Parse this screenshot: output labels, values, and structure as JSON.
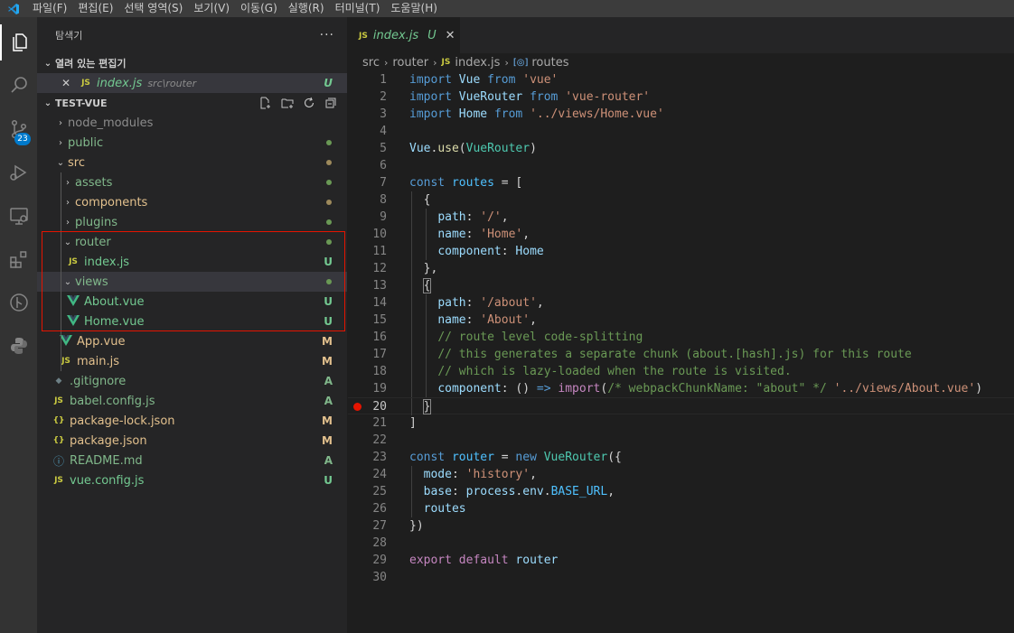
{
  "menu": [
    "파일(F)",
    "편집(E)",
    "선택 영역(S)",
    "보기(V)",
    "이동(G)",
    "실행(R)",
    "터미널(T)",
    "도움말(H)"
  ],
  "activity": {
    "scm_badge": "23"
  },
  "sidebar": {
    "title": "탐색기",
    "more": "···",
    "open_editors": {
      "heading": "열려 있는 편집기",
      "item": {
        "close": "✕",
        "icon": "JS",
        "name": "index.js",
        "path": "src\\router",
        "status": "U"
      }
    },
    "project": {
      "heading": "TEST-VUE"
    },
    "tree": [
      {
        "label": "node_modules",
        "twisty": "›",
        "status": ""
      },
      {
        "label": "public",
        "twisty": "›",
        "status": ""
      },
      {
        "label": "src",
        "twisty": "⌄",
        "status": ""
      },
      {
        "label": "assets",
        "twisty": "›",
        "status": ""
      },
      {
        "label": "components",
        "twisty": "›",
        "status": ""
      },
      {
        "label": "plugins",
        "twisty": "›",
        "status": ""
      },
      {
        "label": "router",
        "twisty": "⌄",
        "status": ""
      },
      {
        "label": "index.js",
        "icon": "JS",
        "status": "U"
      },
      {
        "label": "views",
        "twisty": "⌄",
        "status": ""
      },
      {
        "label": "About.vue",
        "icon": "V",
        "status": "U"
      },
      {
        "label": "Home.vue",
        "icon": "V",
        "status": "U"
      },
      {
        "label": "App.vue",
        "icon": "V",
        "status": "M"
      },
      {
        "label": "main.js",
        "icon": "JS",
        "status": "M"
      },
      {
        "label": ".gitignore",
        "icon": "◆",
        "status": "A"
      },
      {
        "label": "babel.config.js",
        "icon": "JS",
        "status": "A"
      },
      {
        "label": "package-lock.json",
        "icon": "{}",
        "status": "M"
      },
      {
        "label": "package.json",
        "icon": "{}",
        "status": "M"
      },
      {
        "label": "README.md",
        "icon": "ⓘ",
        "status": "A"
      },
      {
        "label": "vue.config.js",
        "icon": "JS",
        "status": "U"
      }
    ]
  },
  "editor": {
    "tab": {
      "icon": "JS",
      "name": "index.js",
      "status": "U",
      "close": "✕"
    },
    "breadcrumb": {
      "folder1": "src",
      "folder2": "router",
      "icon": "JS",
      "file": "index.js",
      "symbol_icon": "[◎]",
      "symbol": "routes"
    },
    "line_numbers": [
      "1",
      "2",
      "3",
      "4",
      "5",
      "6",
      "7",
      "8",
      "9",
      "10",
      "11",
      "12",
      "13",
      "14",
      "15",
      "16",
      "17",
      "18",
      "19",
      "20",
      "21",
      "22",
      "23",
      "24",
      "25",
      "26",
      "27",
      "28",
      "29",
      "30"
    ],
    "breakpoint_line": "20",
    "code": [
      [
        [
          "k",
          "import"
        ],
        [
          "p",
          " "
        ],
        [
          "v",
          "Vue"
        ],
        [
          "p",
          " "
        ],
        [
          "k",
          "from"
        ],
        [
          "p",
          " "
        ],
        [
          "s",
          "'vue'"
        ]
      ],
      [
        [
          "k",
          "import"
        ],
        [
          "p",
          " "
        ],
        [
          "v",
          "VueRouter"
        ],
        [
          "p",
          " "
        ],
        [
          "k",
          "from"
        ],
        [
          "p",
          " "
        ],
        [
          "s",
          "'vue-router'"
        ]
      ],
      [
        [
          "k",
          "import"
        ],
        [
          "p",
          " "
        ],
        [
          "v",
          "Home"
        ],
        [
          "p",
          " "
        ],
        [
          "k",
          "from"
        ],
        [
          "p",
          " "
        ],
        [
          "s",
          "'../views/Home.vue'"
        ]
      ],
      [],
      [
        [
          "v",
          "Vue"
        ],
        [
          "p",
          "."
        ],
        [
          "fn",
          "use"
        ],
        [
          "p",
          "("
        ],
        [
          "cl",
          "VueRouter"
        ],
        [
          "p",
          ")"
        ]
      ],
      [],
      [
        [
          "k",
          "const"
        ],
        [
          "p",
          " "
        ],
        [
          "cn",
          "routes"
        ],
        [
          "p",
          " = ["
        ]
      ],
      [
        [
          "p",
          "  {"
        ]
      ],
      [
        [
          "p",
          "    "
        ],
        [
          "v",
          "path"
        ],
        [
          "p",
          ": "
        ],
        [
          "s",
          "'/'"
        ],
        [
          "p",
          ","
        ]
      ],
      [
        [
          "p",
          "    "
        ],
        [
          "v",
          "name"
        ],
        [
          "p",
          ": "
        ],
        [
          "s",
          "'Home'"
        ],
        [
          "p",
          ","
        ]
      ],
      [
        [
          "p",
          "    "
        ],
        [
          "v",
          "component"
        ],
        [
          "p",
          ": "
        ],
        [
          "v",
          "Home"
        ]
      ],
      [
        [
          "p",
          "  },"
        ]
      ],
      [
        [
          "p",
          "  "
        ],
        [
          "bm",
          "{"
        ]
      ],
      [
        [
          "p",
          "    "
        ],
        [
          "v",
          "path"
        ],
        [
          "p",
          ": "
        ],
        [
          "s",
          "'/about'"
        ],
        [
          "p",
          ","
        ]
      ],
      [
        [
          "p",
          "    "
        ],
        [
          "v",
          "name"
        ],
        [
          "p",
          ": "
        ],
        [
          "s",
          "'About'"
        ],
        [
          "p",
          ","
        ]
      ],
      [
        [
          "p",
          "    "
        ],
        [
          "cm",
          "// route level code-splitting"
        ]
      ],
      [
        [
          "p",
          "    "
        ],
        [
          "cm",
          "// this generates a separate chunk (about.[hash].js) for this route"
        ]
      ],
      [
        [
          "p",
          "    "
        ],
        [
          "cm",
          "// which is lazy-loaded when the route is visited."
        ]
      ],
      [
        [
          "p",
          "    "
        ],
        [
          "v",
          "component"
        ],
        [
          "p",
          ": () "
        ],
        [
          "k",
          "=>"
        ],
        [
          "p",
          " "
        ],
        [
          "kc",
          "import"
        ],
        [
          "p",
          "("
        ],
        [
          "cm",
          "/* webpackChunkName: \"about\" */"
        ],
        [
          "p",
          " "
        ],
        [
          "s",
          "'../views/About.vue'"
        ],
        [
          "p",
          ")"
        ]
      ],
      [
        [
          "p",
          "  "
        ],
        [
          "bm",
          "}"
        ]
      ],
      [
        [
          "p",
          "]"
        ]
      ],
      [],
      [
        [
          "k",
          "const"
        ],
        [
          "p",
          " "
        ],
        [
          "cn",
          "router"
        ],
        [
          "p",
          " = "
        ],
        [
          "k",
          "new"
        ],
        [
          "p",
          " "
        ],
        [
          "cl",
          "VueRouter"
        ],
        [
          "p",
          "({"
        ]
      ],
      [
        [
          "p",
          "  "
        ],
        [
          "v",
          "mode"
        ],
        [
          "p",
          ": "
        ],
        [
          "s",
          "'history'"
        ],
        [
          "p",
          ","
        ]
      ],
      [
        [
          "p",
          "  "
        ],
        [
          "v",
          "base"
        ],
        [
          "p",
          ": "
        ],
        [
          "v",
          "process"
        ],
        [
          "p",
          "."
        ],
        [
          "v",
          "env"
        ],
        [
          "p",
          "."
        ],
        [
          "cn",
          "BASE_URL"
        ],
        [
          "p",
          ","
        ]
      ],
      [
        [
          "p",
          "  "
        ],
        [
          "v",
          "routes"
        ]
      ],
      [
        [
          "p",
          "})"
        ]
      ],
      [],
      [
        [
          "kc",
          "export"
        ],
        [
          "p",
          " "
        ],
        [
          "kc",
          "default"
        ],
        [
          "p",
          " "
        ],
        [
          "v",
          "router"
        ]
      ],
      []
    ]
  }
}
